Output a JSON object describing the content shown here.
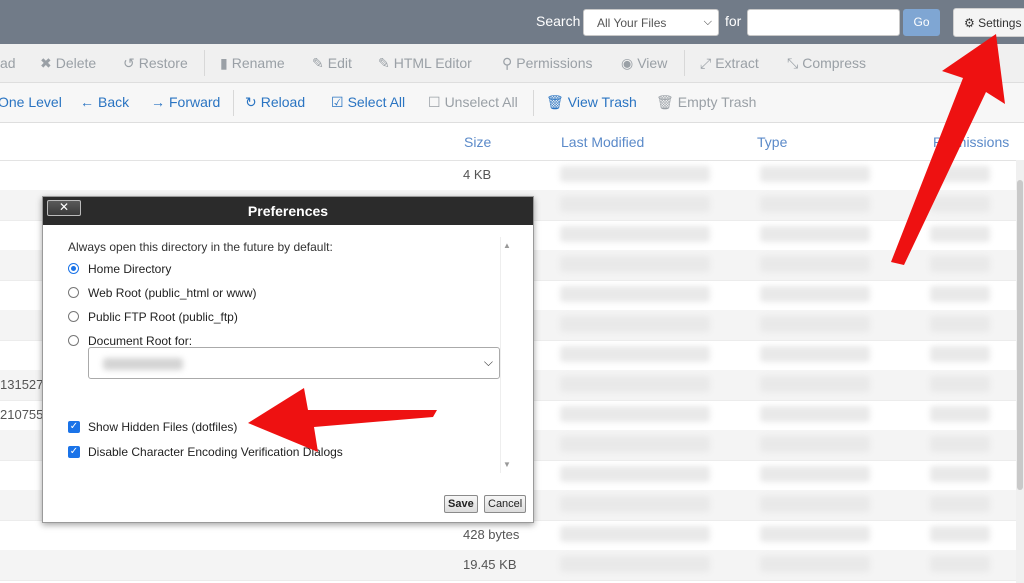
{
  "topbar": {
    "search_label": "Search",
    "scope_selected": "All Your Files",
    "for_label": "for",
    "search_value": "",
    "go_label": "Go",
    "settings_label": "Settings"
  },
  "toolbar_actions": [
    {
      "label": "ad",
      "icon": "upload-icon"
    },
    {
      "label": "Delete",
      "icon": "x-icon"
    },
    {
      "label": "Restore",
      "icon": "restore-icon"
    },
    {
      "label": "Rename",
      "icon": "file-icon"
    },
    {
      "label": "Edit",
      "icon": "pencil-icon"
    },
    {
      "label": "HTML Editor",
      "icon": "html-editor-icon"
    },
    {
      "label": "Permissions",
      "icon": "key-icon"
    },
    {
      "label": "View",
      "icon": "eye-icon"
    },
    {
      "label": "Extract",
      "icon": "expand-icon"
    },
    {
      "label": "Compress",
      "icon": "compress-icon"
    }
  ],
  "toolbar_nav": [
    {
      "label": "One Level"
    },
    {
      "label": "Back",
      "icon": "arrow-left-icon"
    },
    {
      "label": "Forward",
      "icon": "arrow-right-icon"
    },
    {
      "label": "Reload",
      "icon": "reload-icon"
    },
    {
      "label": "Select All",
      "icon": "checkbox-checked-icon"
    },
    {
      "label": "Unselect All",
      "icon": "checkbox-empty-icon"
    },
    {
      "label": "View Trash",
      "icon": "trash-icon"
    },
    {
      "label": "Empty Trash",
      "icon": "trash-icon"
    }
  ],
  "table": {
    "headers": {
      "size": "Size",
      "last_modified": "Last Modified",
      "type": "Type",
      "permissions": "Permissions"
    },
    "rows": [
      {
        "name": "",
        "size": "4 KB"
      },
      {
        "name": "",
        "size": ""
      },
      {
        "name": "",
        "size": ""
      },
      {
        "name": "",
        "size": ""
      },
      {
        "name": "",
        "size": ""
      },
      {
        "name": "",
        "size": ""
      },
      {
        "name": "",
        "size": ""
      },
      {
        "name": "131527",
        "size": ""
      },
      {
        "name": "210755",
        "size": ""
      },
      {
        "name": "",
        "size": ""
      },
      {
        "name": "",
        "size": ""
      },
      {
        "name": "",
        "size": ""
      },
      {
        "name": "",
        "size": "428 bytes"
      },
      {
        "name": "",
        "size": "19.45 KB"
      }
    ]
  },
  "dialog": {
    "title": "Preferences",
    "close_label": "✕",
    "intro": "Always open this directory in the future by default:",
    "options": [
      {
        "label": "Home Directory",
        "selected": true
      },
      {
        "label": "Web Root (public_html or www)",
        "selected": false
      },
      {
        "label": "Public FTP Root (public_ftp)",
        "selected": false
      },
      {
        "label": "Document Root for:",
        "selected": false
      }
    ],
    "checkboxes": [
      {
        "label": "Show Hidden Files (dotfiles)",
        "checked": true
      },
      {
        "label": "Disable Character Encoding Verification Dialogs",
        "checked": true
      }
    ],
    "save_label": "Save",
    "cancel_label": "Cancel"
  },
  "colors": {
    "topbar": "#717b88",
    "link": "#2a74c2",
    "accent": "#1a73e8",
    "annotation": "#ee1111"
  }
}
